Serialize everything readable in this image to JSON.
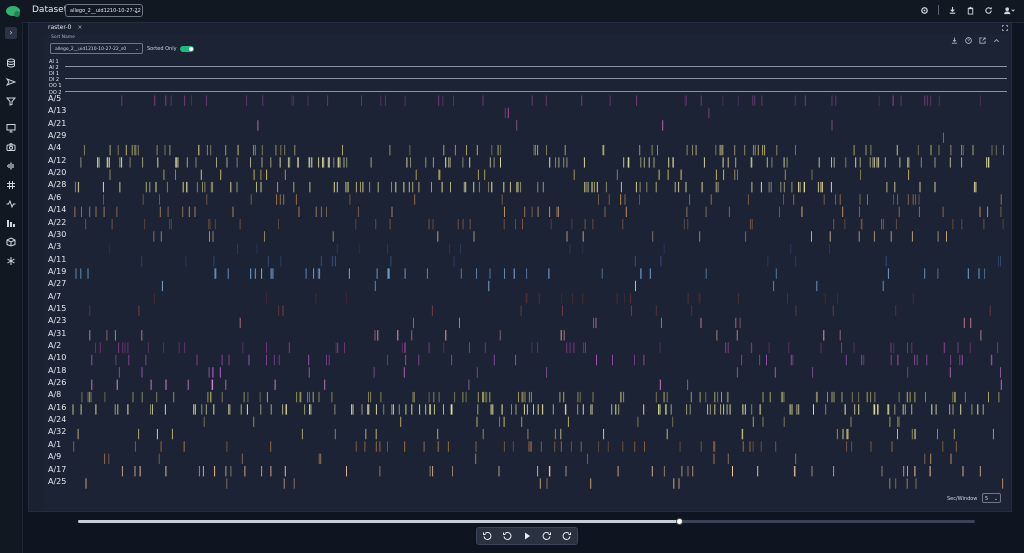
{
  "header": {
    "dataset_label": "Dataset:",
    "dataset_value": "allego_2__uid1210-10-27-22",
    "icons": [
      "gear-icon",
      "download-icon",
      "trash-icon",
      "refresh-icon",
      "user-icon"
    ]
  },
  "sidebar": {
    "toggle_label": "›",
    "icons": [
      "database-icon",
      "send-icon",
      "filter-icon",
      "monitor-icon",
      "camera-icon",
      "waveform-icon",
      "grid-icon",
      "pulse-icon",
      "bar-chart-icon",
      "cube-icon",
      "snowflake-icon"
    ]
  },
  "panel": {
    "tab_label": "raster-0",
    "tab_close": "×",
    "sort_name_label": "Sort Name",
    "sort_name_value": "allego_2__uid1210-10-27-22_s0",
    "sorted_only_label": "Sorted Only",
    "sorted_only_on": true,
    "icons": [
      "download-icon",
      "help-icon",
      "external-link-icon",
      "collapse-icon"
    ]
  },
  "signals": [
    "AI 1",
    "AI 2",
    "DI 1",
    "DI 2",
    "DO 1",
    "DO 2"
  ],
  "rows": [
    {
      "label": "A/5",
      "color": "#7a3a7a"
    },
    {
      "label": "A/13",
      "color": "#b04aa0"
    },
    {
      "label": "A/21",
      "color": "#d070c8"
    },
    {
      "label": "A/29",
      "color": "#d070c8"
    },
    {
      "label": "A/4",
      "color": "#b8b070"
    },
    {
      "label": "A/12",
      "color": "#e0dca0"
    },
    {
      "label": "A/20",
      "color": "#d8c060"
    },
    {
      "label": "A/28",
      "color": "#e0d890"
    },
    {
      "label": "A/6",
      "color": "#a07850"
    },
    {
      "label": "A/14",
      "color": "#c09060"
    },
    {
      "label": "A/22",
      "color": "#805840"
    },
    {
      "label": "A/30",
      "color": "#d0b080"
    },
    {
      "label": "A/3",
      "color": "#2a3a5a"
    },
    {
      "label": "A/11",
      "color": "#3a5080"
    },
    {
      "label": "A/19",
      "color": "#7ab0e8"
    },
    {
      "label": "A/27",
      "color": "#a0d0ff"
    },
    {
      "label": "A/7",
      "color": "#5a3030"
    },
    {
      "label": "A/15",
      "color": "#7a4040"
    },
    {
      "label": "A/23",
      "color": "#d08090"
    },
    {
      "label": "A/31",
      "color": "#f0a0a0"
    },
    {
      "label": "A/2",
      "color": "#8a3a8a"
    },
    {
      "label": "A/10",
      "color": "#a050b0"
    },
    {
      "label": "A/18",
      "color": "#c068c8"
    },
    {
      "label": "A/26",
      "color": "#f090e8"
    },
    {
      "label": "A/8",
      "color": "#b0a860"
    },
    {
      "label": "A/16",
      "color": "#e8e4a0"
    },
    {
      "label": "A/24",
      "color": "#c8b860"
    },
    {
      "label": "A/32",
      "color": "#e0d080"
    },
    {
      "label": "A/1",
      "color": "#a07040"
    },
    {
      "label": "A/9",
      "color": "#c09060"
    },
    {
      "label": "A/17",
      "color": "#f0c8a0"
    },
    {
      "label": "A/25",
      "color": "#d8a878"
    }
  ],
  "footer": {
    "sec_window_label": "Sec/Window",
    "sec_window_value": "5",
    "timeline_progress": 0.67
  },
  "transport": {
    "buttons": [
      "rewind-10-icon",
      "rewind-5-icon",
      "play-icon",
      "forward-5-icon",
      "forward-10-icon"
    ]
  }
}
